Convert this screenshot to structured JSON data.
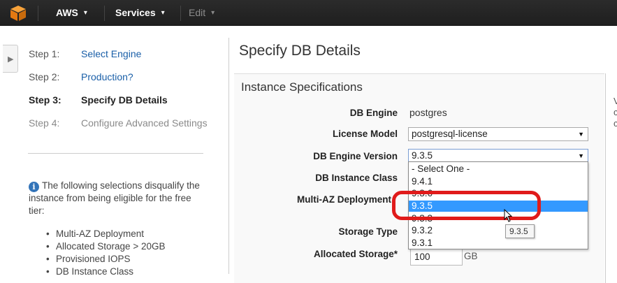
{
  "topbar": {
    "brand": "AWS",
    "services": "Services",
    "edit": "Edit",
    "caret": "▾"
  },
  "steps": [
    {
      "num": "Step 1:",
      "label": "Select Engine"
    },
    {
      "num": "Step 2:",
      "label": "Production?"
    },
    {
      "num": "Step 3:",
      "label": "Specify DB Details"
    },
    {
      "num": "Step 4:",
      "label": "Configure Advanced Settings"
    }
  ],
  "info": {
    "icon": "i",
    "text": "The following selections disqualify the instance from being eligible for the free tier:",
    "items": [
      "Multi-AZ Deployment",
      "Allocated Storage > 20GB",
      "Provisioned IOPS",
      "DB Instance Class"
    ]
  },
  "page_title": "Specify DB Details",
  "section_title": "Instance Specifications",
  "right_panel_text": [
    "V",
    "c",
    "c"
  ],
  "fields": {
    "db_engine": {
      "label": "DB Engine",
      "value": "postgres"
    },
    "license_model": {
      "label": "License Model",
      "value": "postgresql-license"
    },
    "engine_version": {
      "label": "DB Engine Version",
      "value": "9.3.5"
    },
    "instance_class": {
      "label": "DB Instance Class"
    },
    "multi_az": {
      "label": "Multi-AZ Deployment"
    },
    "storage_type": {
      "label": "Storage Type"
    },
    "allocated_storage": {
      "label": "Allocated Storage*",
      "value": "100",
      "unit": "GB"
    }
  },
  "dropdown_options": [
    "- Select One -",
    "9.4.1",
    "9.3.6",
    "9.3.5",
    "9.3.3",
    "9.3.2",
    "9.3.1"
  ],
  "dropdown_selected": "9.3.5",
  "tooltip": "9.3.5",
  "colors": {
    "selected": "#3399ff",
    "highlight": "#e01b1b",
    "link": "#1a5fa8"
  }
}
